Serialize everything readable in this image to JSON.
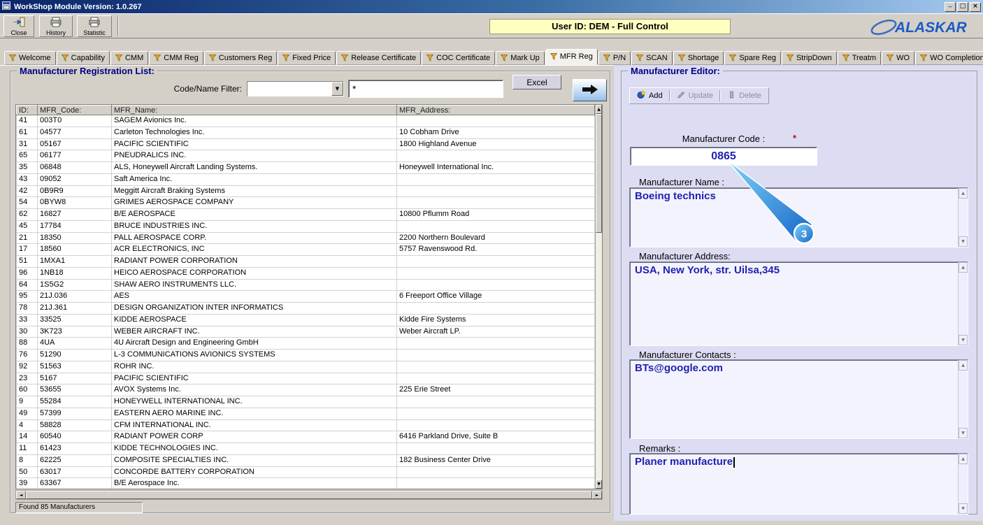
{
  "colors": {
    "title-navy": "#000080",
    "banner-bg": "#ffffc2",
    "panel-periwinkle": "#dcdcf2",
    "field-text-blue": "#2121b2",
    "callout-blue": "#1565c8",
    "logo-blue": "#1a5ac8"
  },
  "window": {
    "title": "WorkShop Module  Version: 1.0.267",
    "user_banner": "User ID: DEM - Full Control",
    "logo_text": "ALASKAR"
  },
  "toolbar": {
    "buttons": [
      "Close",
      "History",
      "Statistic"
    ]
  },
  "tabs": {
    "active": "MFR Reg",
    "items": [
      "Welcome",
      "Capability",
      "CMM",
      "CMM Reg",
      "Customers Reg",
      "Fixed Price",
      "Release Certificate",
      "COC Certificate",
      "Mark Up",
      "MFR Reg",
      "P/N",
      "SCAN",
      "Shortage",
      "Spare Reg",
      "StripDown",
      "Treatm",
      "WO",
      "WO Completion"
    ]
  },
  "list_panel": {
    "title": "Manufacturer Registration List:",
    "filter_label": "Code/Name Filter:",
    "filter_value": "",
    "search_value": "*",
    "excel_button": "Excel",
    "columns": [
      "ID:",
      "MFR_Code:",
      "MFR_Name:",
      "MFR_Address:"
    ],
    "rows": [
      [
        "41",
        "003T0",
        "SAGEM Avionics Inc.",
        ""
      ],
      [
        "61",
        "04577",
        "Carleton Technologies Inc.",
        "10 Cobham Drive"
      ],
      [
        "31",
        "05167",
        "PACIFIC SCIENTIFIC",
        "1800 Highland Avenue"
      ],
      [
        "65",
        "06177",
        "PNEUDRALICS INC.",
        ""
      ],
      [
        "35",
        "06848",
        "ALS, Honeywell Aircraft Landing Systems.",
        "Honeywell International Inc."
      ],
      [
        "43",
        "09052",
        "Saft America Inc.",
        ""
      ],
      [
        "42",
        "0B9R9",
        "Meggitt Aircraft Braking Systems",
        ""
      ],
      [
        "54",
        "0BYW8",
        "GRIMES AEROSPACE COMPANY",
        ""
      ],
      [
        "62",
        "16827",
        "B/E AEROSPACE",
        "10800 Pflumm Road"
      ],
      [
        "45",
        "17784",
        "BRUCE INDUSTRIES INC.",
        ""
      ],
      [
        "21",
        "18350",
        "PALL AEROSPACE CORP.",
        "2200 Northern Boulevard"
      ],
      [
        "17",
        "18560",
        "ACR ELECTRONICS, INC",
        "5757 Ravenswood Rd."
      ],
      [
        "51",
        "1MXA1",
        "RADIANT POWER CORPORATION",
        ""
      ],
      [
        "96",
        "1NB18",
        "HEICO AEROSPACE CORPORATION",
        ""
      ],
      [
        "64",
        "1S5G2",
        "SHAW AERO INSTRUMENTS LLC.",
        ""
      ],
      [
        "95",
        "21J.036",
        "AES",
        "6 Freeport Office Village"
      ],
      [
        "78",
        "21J.361",
        "DESIGN ORGANIZATION INTER INFORMATICS",
        ""
      ],
      [
        "33",
        "33525",
        "KIDDE AEROSPACE",
        "Kidde Fire Systems"
      ],
      [
        "30",
        "3K723",
        "WEBER AIRCRAFT INC.",
        "Weber Aircraft  LP."
      ],
      [
        "88",
        "4UA",
        "4U Aircraft Design and Engineering GmbH",
        ""
      ],
      [
        "76",
        "51290",
        "L-3 COMMUNICATIONS AVIONICS SYSTEMS",
        ""
      ],
      [
        "92",
        "51563",
        "ROHR INC.",
        ""
      ],
      [
        "23",
        "5167",
        "PACIFIC SCIENTIFIC",
        ""
      ],
      [
        "60",
        "53655",
        "AVOX Systems Inc.",
        "225 Erie Street"
      ],
      [
        "9",
        "55284",
        "HONEYWELL INTERNATIONAL INC.",
        ""
      ],
      [
        "49",
        "57399",
        "EASTERN AERO MARINE INC.",
        ""
      ],
      [
        "4",
        "58828",
        "CFM INTERNATIONAL INC.",
        ""
      ],
      [
        "14",
        "60540",
        "RADIANT POWER CORP",
        "6416 Parkland Drive, Suite B"
      ],
      [
        "11",
        "61423",
        "KIDDE TECHNOLOGIES INC.",
        ""
      ],
      [
        "8",
        "62225",
        "COMPOSITE SPECIALTIES INC.",
        "182 Business Center Drive"
      ],
      [
        "50",
        "63017",
        "CONCORDE BATTERY CORPORATION",
        ""
      ],
      [
        "39",
        "63367",
        "B/E Aerospace Inc.",
        ""
      ]
    ],
    "status": "Found 85 Manufacturers"
  },
  "editor_panel": {
    "title": "Manufacturer Editor:",
    "buttons": {
      "add": "Add",
      "update": "Update",
      "delete": "Delete"
    },
    "code_label": "Manufacturer Code :",
    "required_marker": "*",
    "code_value": "0865",
    "name_label": "Manufacturer Name :",
    "name_value": "Boeing technics",
    "address_label": "Manufacturer Address:",
    "address_value": "USA, New York, str. Uilsa,345",
    "contacts_label": "Manufacturer Contacts :",
    "contacts_value": "BTs@google.com",
    "remarks_label": "Remarks :",
    "remarks_value": "Planer manufacture",
    "callout_number": "3"
  }
}
